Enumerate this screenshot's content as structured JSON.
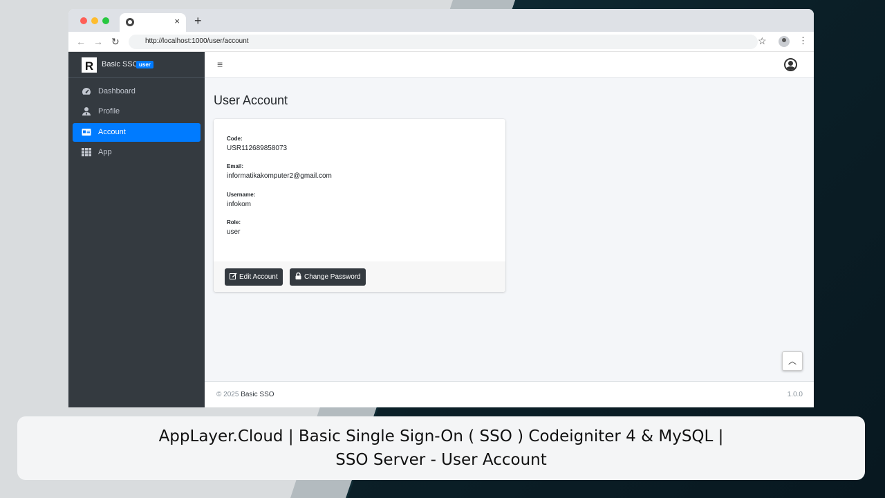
{
  "browser": {
    "tab_close": "×",
    "new_tab": "+",
    "url": "http://localhost:1000/user/account"
  },
  "sidebar": {
    "brand_logo": "R",
    "brand_name": "Basic SSO",
    "brand_badge": "user",
    "items": [
      {
        "label": "Dashboard",
        "icon": "tachometer-icon"
      },
      {
        "label": "Profile",
        "icon": "user-tie-icon"
      },
      {
        "label": "Account",
        "icon": "id-card-icon",
        "active": true
      },
      {
        "label": "App",
        "icon": "grid-icon"
      }
    ]
  },
  "page": {
    "title": "User Account",
    "fields": [
      {
        "label": "Code:",
        "value": "USR112689858073"
      },
      {
        "label": "Email:",
        "value": "informatikakomputer2@gmail.com"
      },
      {
        "label": "Username:",
        "value": "infokom"
      },
      {
        "label": "Role:",
        "value": "user"
      }
    ],
    "buttons": {
      "edit": "Edit Account",
      "change_password": "Change Password"
    }
  },
  "footer": {
    "copyright": "© 2025",
    "app_name": "Basic SSO",
    "version": "1.0.0"
  },
  "caption": {
    "line1": "AppLayer.Cloud | Basic Single Sign-On ( SSO ) Codeigniter 4 & MySQL |",
    "line2": "SSO Server - User Account"
  },
  "colors": {
    "sidebar": "#343a40",
    "active": "#007bff",
    "button": "#343a40"
  }
}
